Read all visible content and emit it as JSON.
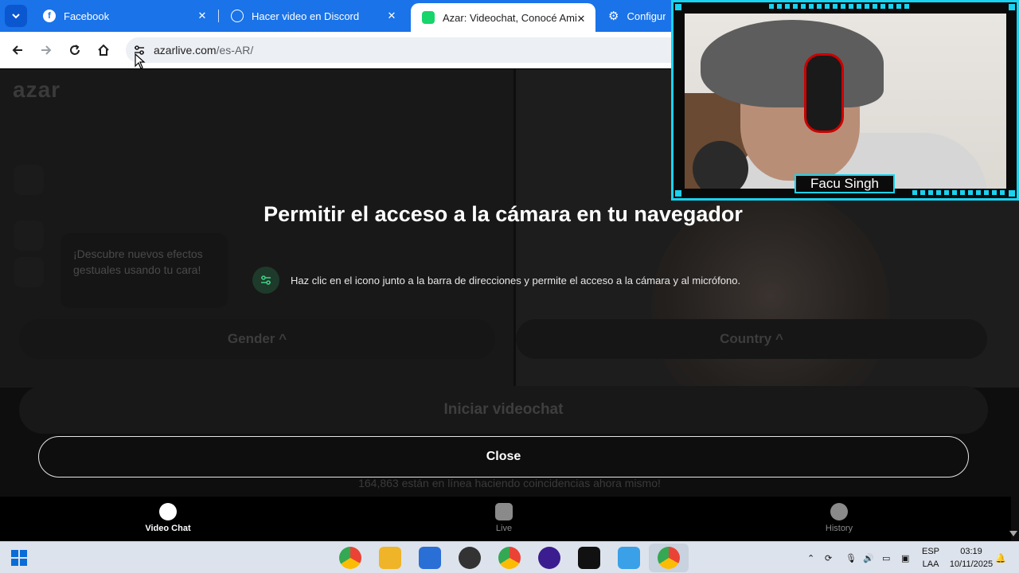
{
  "tabs": [
    {
      "title": "Facebook",
      "icon": "facebook-icon"
    },
    {
      "title": "Hacer video en Discord",
      "icon": "chatgpt-icon"
    },
    {
      "title": "Azar: Videochat, Conocé Amigo",
      "icon": "azar-icon"
    },
    {
      "title": "Configurac",
      "icon": "settings-icon"
    }
  ],
  "address": {
    "host": "azarlive.com",
    "path": "/es-AR/"
  },
  "page": {
    "logo": "azar",
    "gesture_popup": "¡Descubre nuevos efectos gestuales usando tu cara!",
    "gender_label": "Gender ^",
    "country_label": "Country ^",
    "start_label": "Iniciar videochat",
    "online_text": "164,863 están en línea haciendo coincidencias ahora mismo!"
  },
  "modal": {
    "title": "Permitir el acceso a la cámara en tu navegador",
    "instruction": "Haz clic en el icono junto a la barra de direcciones y permite el acceso a la cámara y al micrófono.",
    "close_label": "Close"
  },
  "bottom_nav": [
    {
      "label": "Video Chat",
      "active": true
    },
    {
      "label": "Live",
      "active": false
    },
    {
      "label": "History",
      "active": false
    }
  ],
  "stream_overlay": {
    "streamer_name": "Facu Singh"
  },
  "taskbar": {
    "lang_top": "ESP",
    "lang_bottom": "LAA",
    "time": "03:19",
    "date": "10/11/2025"
  },
  "colors": {
    "accent": "#18d3f0",
    "tab_bar": "#1a73e8",
    "step_icon": "#1e3a2b"
  }
}
